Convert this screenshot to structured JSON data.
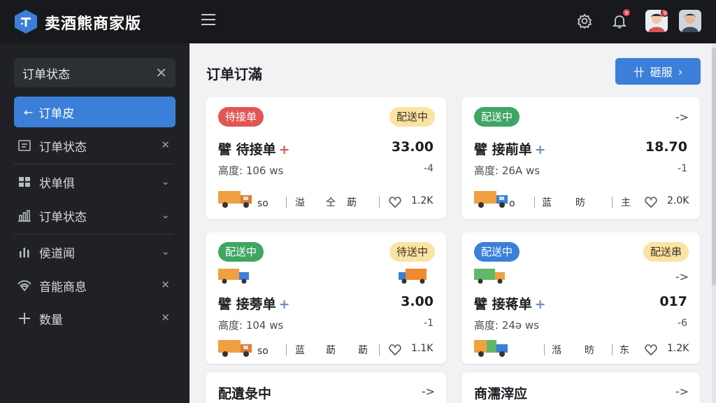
{
  "app": {
    "title": "卖酒熊商家版"
  },
  "topbar": {
    "bell_badge": "9",
    "avatar_badge": "9"
  },
  "sidebar": {
    "search_value": "订单状态",
    "search_clear": "✕",
    "active_item": {
      "arrow": "←",
      "label": "订单皮"
    },
    "items": [
      {
        "label": "订单状态",
        "trail": "✕",
        "icon": "list-icon"
      },
      {
        "label": "状单俱",
        "trail": "⌄",
        "icon": "grid-icon"
      },
      {
        "label": "订单状态",
        "trail": "⌄",
        "icon": "chart-icon"
      },
      {
        "label": "侯道闻",
        "trail": "⌄",
        "icon": "bars-icon"
      },
      {
        "label": "音能商息",
        "trail": "✕",
        "icon": "wifi-icon"
      },
      {
        "label": "数量",
        "trail": "✕",
        "icon": "plus-icon"
      }
    ]
  },
  "main": {
    "page_title": "订单订滿",
    "top_button": {
      "icon": "卄",
      "label": "砸服",
      "chevron": "›"
    },
    "cards": [
      {
        "left_pill": "待接单",
        "right_pill": "配送中",
        "title": "譬 待接单",
        "plus": "+",
        "amount": "33.00",
        "meta": "高度: 106 ws",
        "meta_r": "-4",
        "foot": [
          "so",
          "溢",
          "仝",
          "莇"
        ],
        "likes": "1.2K"
      },
      {
        "left_pill": "配送中",
        "chevron": "->",
        "title": "譬 接萷单",
        "plus": "+",
        "amount": "18.70",
        "meta": "高度: 26A ws",
        "meta_r": "-1",
        "foot": [
          "o",
          "蓝",
          "昉",
          "主"
        ],
        "likes": "2.0K"
      },
      {
        "left_pill": "配送中",
        "right_pill": "待送中",
        "title": "譬 接蒡单",
        "plus": "+",
        "amount": "3.00",
        "meta": "高度: 104 ws",
        "meta_r": "-1",
        "foot": [
          "so",
          "蓝",
          "莇",
          "莇"
        ],
        "likes": "1.1K"
      },
      {
        "left_pill": "配送中",
        "right_pill": "配送串",
        "chevron": "->",
        "title": "譬 接蒋单",
        "plus": "+",
        "amount": "017",
        "meta": "高度: 24ə ws",
        "meta_r": "-6",
        "foot": [
          "湉",
          "昉",
          "东"
        ],
        "likes": "1.2K"
      },
      {
        "title": "配遺彔中",
        "chevron": "->"
      },
      {
        "title": "商濡滓应",
        "chevron": "->"
      }
    ]
  }
}
